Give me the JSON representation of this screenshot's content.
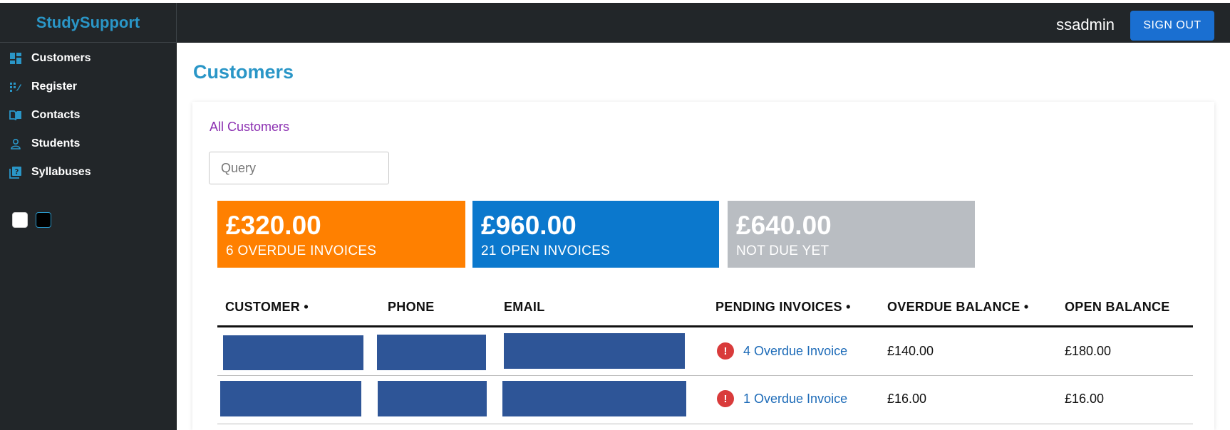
{
  "app": {
    "brand": "StudySupport",
    "username": "ssadmin",
    "sign_out_label": "SIGN OUT"
  },
  "sidebar": {
    "items": [
      {
        "label": "Customers",
        "icon": "dashboard-icon"
      },
      {
        "label": "Register",
        "icon": "register-icon"
      },
      {
        "label": "Contacts",
        "icon": "book-open-icon"
      },
      {
        "label": "Students",
        "icon": "person-icon"
      },
      {
        "label": "Syllabuses",
        "icon": "question-book-icon"
      }
    ],
    "theme_swatches": [
      {
        "name": "light",
        "color": "#ffffff"
      },
      {
        "name": "dark",
        "color": "#000000"
      }
    ]
  },
  "main": {
    "title": "Customers",
    "filter_link": "All Customers",
    "search": {
      "placeholder": "Query",
      "value": ""
    },
    "stats": [
      {
        "amount": "£320.00",
        "label": "6 OVERDUE INVOICES",
        "color": "#ff8000"
      },
      {
        "amount": "£960.00",
        "label": "21 OPEN INVOICES",
        "color": "#0b78cd"
      },
      {
        "amount": "£640.00",
        "label": "NOT DUE YET",
        "color": "#b9bdc2"
      }
    ],
    "table": {
      "headers": [
        "CUSTOMER •",
        "PHONE",
        "EMAIL",
        "PENDING INVOICES •",
        "OVERDUE BALANCE •",
        "OPEN BALANCE"
      ],
      "rows": [
        {
          "pending": "4 Overdue Invoice",
          "overdue_balance": "£140.00",
          "open_balance": "£180.00"
        },
        {
          "pending": "1 Overdue Invoice",
          "overdue_balance": "£16.00",
          "open_balance": "£16.00"
        }
      ]
    }
  },
  "colors": {
    "accent": "#2a96c7",
    "redaction": "#2e5597",
    "alert": "#d93b3b",
    "link": "#1d6bb8"
  }
}
